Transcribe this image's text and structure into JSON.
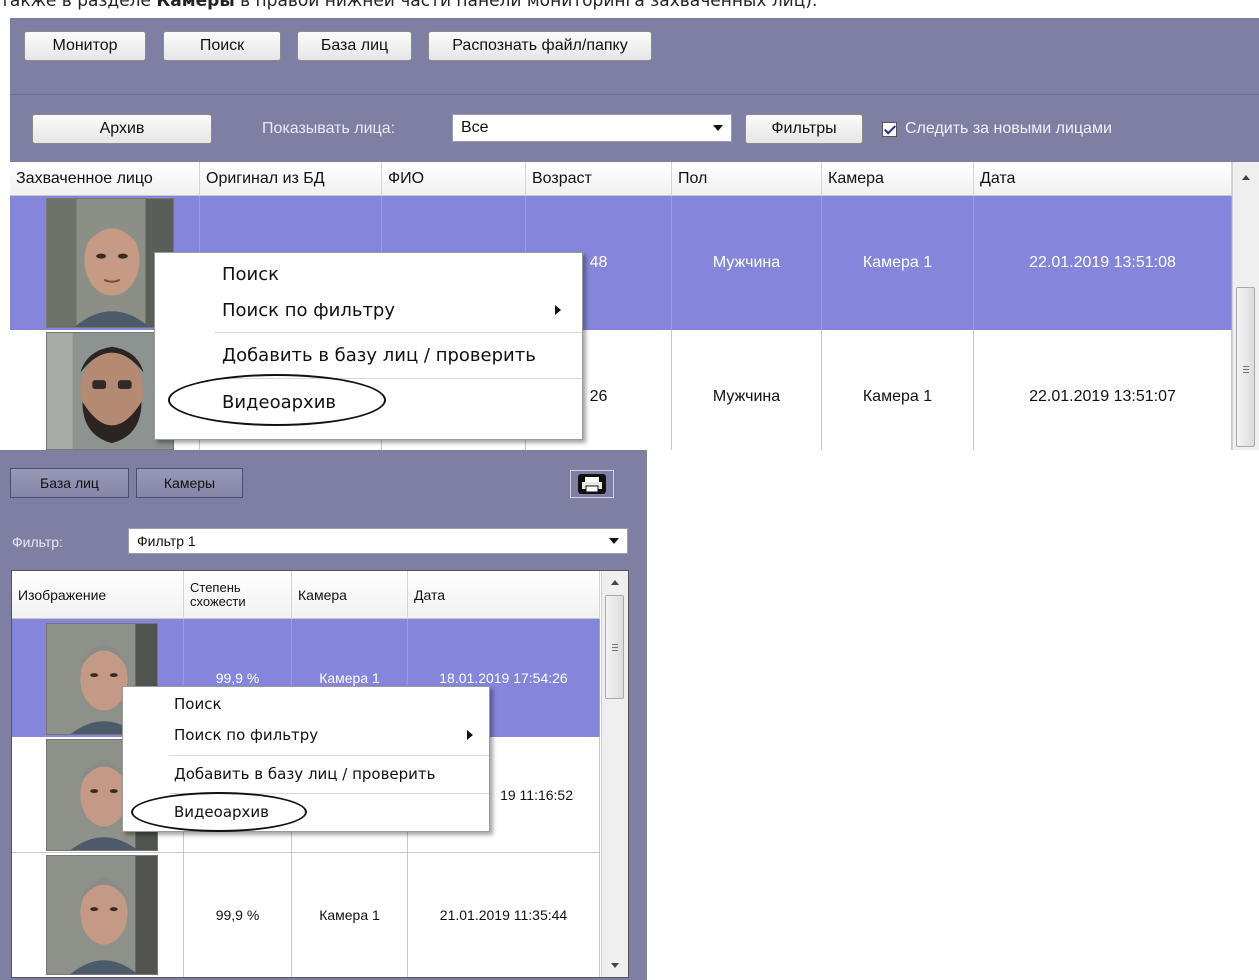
{
  "header_text": {
    "prefix": "также в разделе ",
    "bold": "Камеры",
    "suffix": " в правой нижней части панели мониторинга захваченных лиц)."
  },
  "top_window": {
    "toolbar": [
      "Монитор",
      "Поиск",
      "База лиц",
      "Распознать файл/папку"
    ],
    "archive_button": "Архив",
    "show_faces_label": "Показывать лица:",
    "show_faces_value": "Все",
    "filters_button": "Фильтры",
    "follow_new_faces": {
      "label": "Следить за новыми лицами",
      "checked": true
    },
    "columns": [
      "Захваченное лицо",
      "Оригинал из БД",
      "ФИО",
      "Возраст",
      "Пол",
      "Камера",
      "Дата"
    ],
    "rows": [
      {
        "original": "",
        "name": "",
        "age": "48",
        "gender": "Мужчина",
        "camera": "Камера 1",
        "date": "22.01.2019 13:51:08",
        "selected": true
      },
      {
        "original": "",
        "name": "",
        "age": "26",
        "gender": "Мужчина",
        "camera": "Камера 1",
        "date": "22.01.2019 13:51:07",
        "selected": false
      }
    ],
    "context_menu": {
      "search": "Поиск",
      "search_by_filter": "Поиск по фильтру",
      "add_to_db": "Добавить в базу лиц / проверить",
      "video_archive": "Видеоархив"
    }
  },
  "bottom_window": {
    "tabs": [
      "База лиц",
      "Камеры"
    ],
    "filter_label": "Фильтр:",
    "filter_value": "Фильтр 1",
    "columns": {
      "image": "Изображение",
      "similarity": "Степень схожести",
      "camera": "Камера",
      "date": "Дата"
    },
    "rows": [
      {
        "similarity": "99,9 %",
        "camera": "Камера 1",
        "date": "18.01.2019 17:54:26",
        "selected": true
      },
      {
        "similarity": "",
        "camera": "",
        "date": "19 11:16:52",
        "selected": false
      },
      {
        "similarity": "99,9 %",
        "camera": "Камера 1",
        "date": "21.01.2019 11:35:44",
        "selected": false
      }
    ],
    "context_menu": {
      "search": "Поиск",
      "search_by_filter": "Поиск по фильтру",
      "add_to_db": "Добавить в базу лиц / проверить",
      "video_archive": "Видеоархив"
    }
  },
  "icons": [
    "checkbox-checked-icon",
    "dropdown-arrow-icon",
    "submenu-arrow-icon",
    "scroll-up-icon",
    "scroll-down-icon",
    "scroll-grip-icon",
    "printer-icon"
  ]
}
